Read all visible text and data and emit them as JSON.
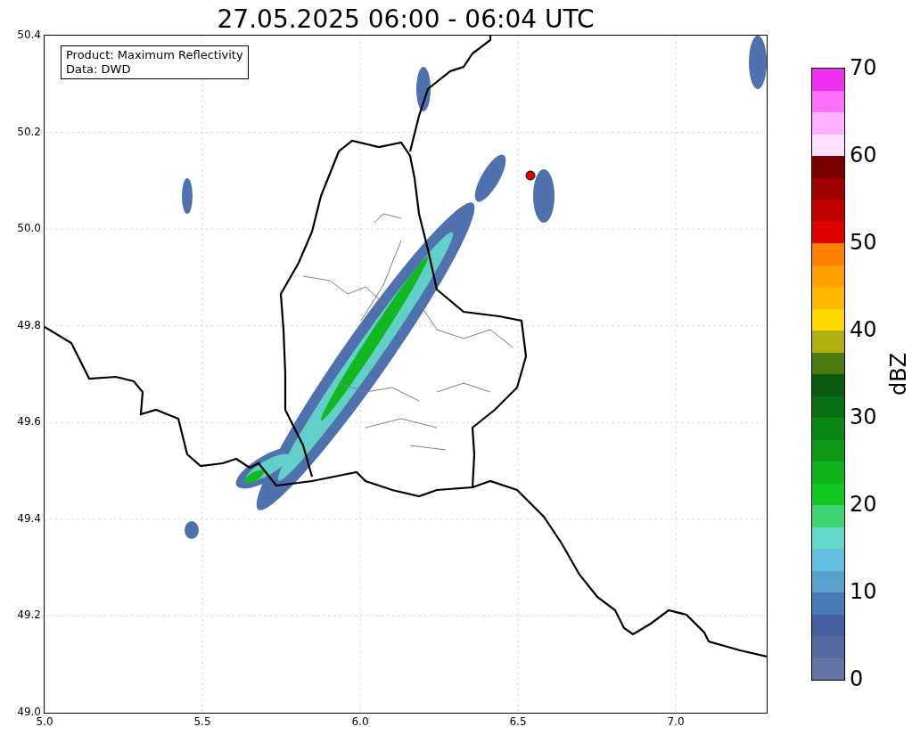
{
  "title": "27.05.2025 06:00 - 06:04 UTC",
  "info_box": [
    "Product: Maximum Reflectivity",
    "Data: DWD"
  ],
  "map": {
    "x_ticks": [
      "5.0",
      "5.5",
      "6.0",
      "6.5",
      "7.0"
    ],
    "y_ticks": [
      "50.4",
      "50.2",
      "50.0",
      "49.8",
      "49.6",
      "49.4",
      "49.2",
      "49.0"
    ]
  },
  "colorbar": {
    "label": "dBZ",
    "ticks": [
      "70",
      "60",
      "50",
      "40",
      "30",
      "20",
      "10",
      "0"
    ],
    "levels": [
      {
        "color": "#6474a6"
      },
      {
        "color": "#5668a0"
      },
      {
        "color": "#4460a0"
      },
      {
        "color": "#4a7ab4"
      },
      {
        "color": "#5aa0cc"
      },
      {
        "color": "#64c0e0"
      },
      {
        "color": "#62d8c8"
      },
      {
        "color": "#3ed672"
      },
      {
        "color": "#12c820"
      },
      {
        "color": "#10b41a"
      },
      {
        "color": "#0e9a16"
      },
      {
        "color": "#0a8614"
      },
      {
        "color": "#0a6e14"
      },
      {
        "color": "#0a5a10"
      },
      {
        "color": "#4a7a10"
      },
      {
        "color": "#b0b010"
      },
      {
        "color": "#ffd800"
      },
      {
        "color": "#ffb800"
      },
      {
        "color": "#ffa000"
      },
      {
        "color": "#ff8000"
      },
      {
        "color": "#e00000"
      },
      {
        "color": "#c00000"
      },
      {
        "color": "#a00000"
      },
      {
        "color": "#7a0000"
      },
      {
        "color": "#ffe0ff"
      },
      {
        "color": "#ffb0ff"
      },
      {
        "color": "#ff70ff"
      },
      {
        "color": "#f030f0"
      }
    ]
  }
}
